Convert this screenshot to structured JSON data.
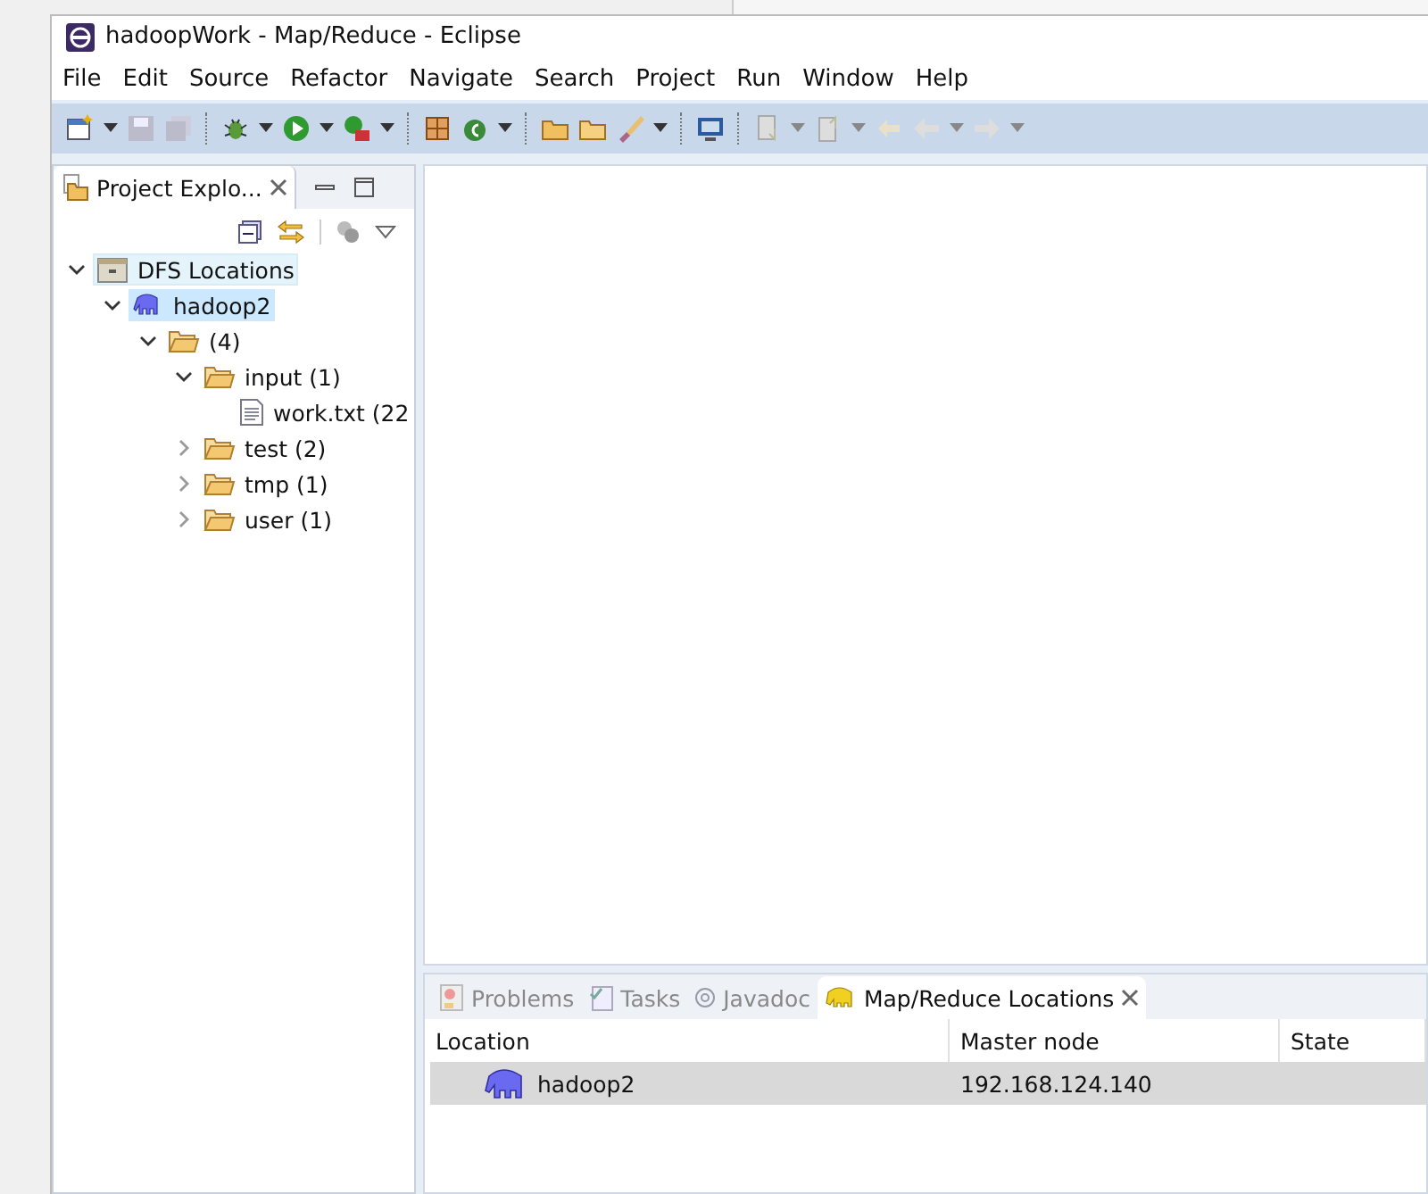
{
  "window": {
    "title": "hadoopWork - Map/Reduce - Eclipse"
  },
  "menu": [
    "File",
    "Edit",
    "Source",
    "Refactor",
    "Navigate",
    "Search",
    "Project",
    "Run",
    "Window",
    "Help"
  ],
  "explorer": {
    "tab": {
      "label": "Project Explo...",
      "selected": true
    },
    "tree": [
      {
        "label": "DFS Locations",
        "kind": "root",
        "expanded": true,
        "selected": false,
        "hovered": true,
        "children": [
          {
            "label": "hadoop2",
            "kind": "location",
            "expanded": true,
            "selected": true,
            "hovered": false,
            "children": [
              {
                "label": "(4)",
                "kind": "folder",
                "expanded": true,
                "selected": false,
                "hovered": false,
                "children": [
                  {
                    "label": "input (1)",
                    "kind": "folder",
                    "expanded": true,
                    "selected": false,
                    "hovered": false,
                    "children": [
                      {
                        "label": "work.txt (22",
                        "kind": "file",
                        "selected": false,
                        "hovered": false
                      }
                    ]
                  },
                  {
                    "label": "test (2)",
                    "kind": "folder",
                    "expanded": false,
                    "selected": false,
                    "hovered": false
                  },
                  {
                    "label": "tmp (1)",
                    "kind": "folder",
                    "expanded": false,
                    "selected": false,
                    "hovered": false
                  },
                  {
                    "label": "user (1)",
                    "kind": "folder",
                    "expanded": false,
                    "selected": false,
                    "hovered": false
                  }
                ]
              }
            ]
          }
        ]
      }
    ]
  },
  "bottom_panel": {
    "tabs": [
      {
        "label": "Problems",
        "kind": "problems",
        "selected": false,
        "closable": false
      },
      {
        "label": "Tasks",
        "kind": "tasks",
        "selected": false,
        "closable": false
      },
      {
        "label": "Javadoc",
        "kind": "javadoc",
        "selected": false,
        "closable": false
      },
      {
        "label": "Map/Reduce Locations",
        "kind": "mapreduce",
        "selected": true,
        "closable": true
      }
    ],
    "table": {
      "columns": [
        "Location",
        "Master node",
        "State"
      ],
      "rows": [
        {
          "location": "hadoop2",
          "master_node": "192.168.124.140",
          "selected": true
        }
      ]
    }
  }
}
